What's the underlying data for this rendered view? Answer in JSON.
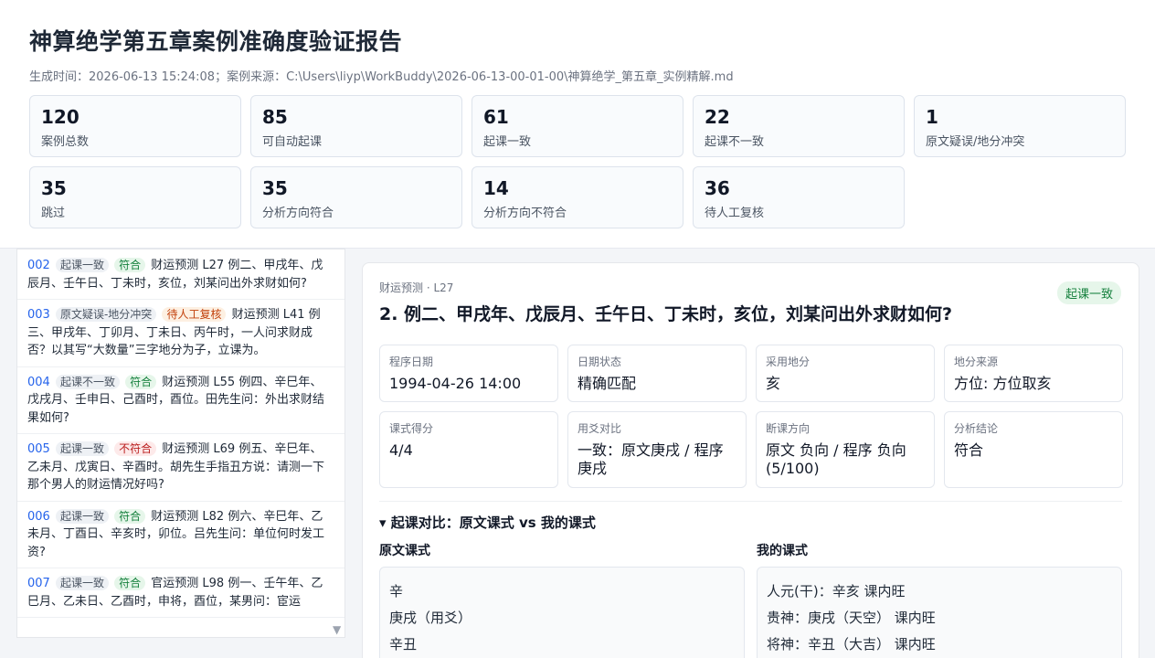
{
  "report": {
    "title": "神算绝学第五章案例准确度验证报告",
    "meta": "生成时间：2026-06-13 15:24:08；案例来源：C:\\Users\\liyp\\WorkBuddy\\2026-06-13-00-01-00\\神算绝学_第五章_实例精解.md"
  },
  "stats": [
    {
      "num": "120",
      "label": "案例总数"
    },
    {
      "num": "85",
      "label": "可自动起课"
    },
    {
      "num": "61",
      "label": "起课一致"
    },
    {
      "num": "22",
      "label": "起课不一致"
    },
    {
      "num": "1",
      "label": "原文疑误/地分冲突"
    },
    {
      "num": "35",
      "label": "跳过"
    },
    {
      "num": "35",
      "label": "分析方向符合"
    },
    {
      "num": "14",
      "label": "分析方向不符合"
    },
    {
      "num": "36",
      "label": "待人工复核"
    }
  ],
  "cases": [
    {
      "idx": "002",
      "tag1": "起课一致",
      "tag2": "符合",
      "text": "财运预测 L27 例二、甲戌年、戊辰月、壬午日、丁未时，亥位，刘某问出外求财如何?"
    },
    {
      "idx": "003",
      "tag1": "原文疑误-地分冲突",
      "tag2": "待人工复核",
      "text": "财运预测 L41 例三、甲戌年、丁卯月、丁未日、丙午时，一人问求财成否？以其写“大数量”三字地分为子，立课为。"
    },
    {
      "idx": "004",
      "tag1": "起课不一致",
      "tag2": "符合",
      "text": "财运预测 L55 例四、辛巳年、戊戌月、壬申日、己酉时，酉位。田先生问：外出求财结果如何?"
    },
    {
      "idx": "005",
      "tag1": "起课一致",
      "tag2": "不符合",
      "text": "财运预测 L69 例五、辛巳年、乙未月、戊寅日、辛酉时。胡先生手指丑方说：请测一下那个男人的财运情况好吗?"
    },
    {
      "idx": "006",
      "tag1": "起课一致",
      "tag2": "符合",
      "text": "财运预测 L82 例六、辛巳年、乙未月、丁酉日、辛亥时，卯位。吕先生问：单位何时发工资?"
    },
    {
      "idx": "007",
      "tag1": "起课一致",
      "tag2": "符合",
      "text": "官运预测 L98 例一、壬午年、乙巳月、乙未日、乙酉时，申将，酉位，某男问：宦运"
    }
  ],
  "detail": {
    "crumb": "财运预测 · L27",
    "status": "起课一致",
    "title": "2. 例二、甲戌年、戊辰月、壬午日、丁未时，亥位，刘某问出外求财如何?",
    "fields": [
      {
        "k": "程序日期",
        "v": "1994-04-26 14:00"
      },
      {
        "k": "日期状态",
        "v": "精确匹配"
      },
      {
        "k": "采用地分",
        "v": "亥"
      },
      {
        "k": "地分来源",
        "v": "方位: 方位取亥"
      },
      {
        "k": "课式得分",
        "v": "4/4"
      },
      {
        "k": "用爻对比",
        "v": "一致：原文庚戌 / 程序庚戌"
      },
      {
        "k": "断课方向",
        "v": "原文 负向 / 程序 负向 (5/100)"
      },
      {
        "k": "分析结论",
        "v": "符合"
      }
    ],
    "section": "▾ 起课对比：原文课式 vs 我的课式",
    "original": {
      "heading": "原文课式",
      "lines": [
        "辛",
        "庚戌（用爻）",
        "辛丑"
      ]
    },
    "mine": {
      "heading": "我的课式",
      "lines": [
        "人元(干)：辛亥  课内旺",
        "贵神：庚戌（天空）  课内旺",
        "将神：辛丑（大吉）  课内旺"
      ]
    }
  },
  "colors": {
    "accent": "#2563eb",
    "ok": "#15803d",
    "bad": "#b91c1c",
    "warn": "#c2410c"
  }
}
